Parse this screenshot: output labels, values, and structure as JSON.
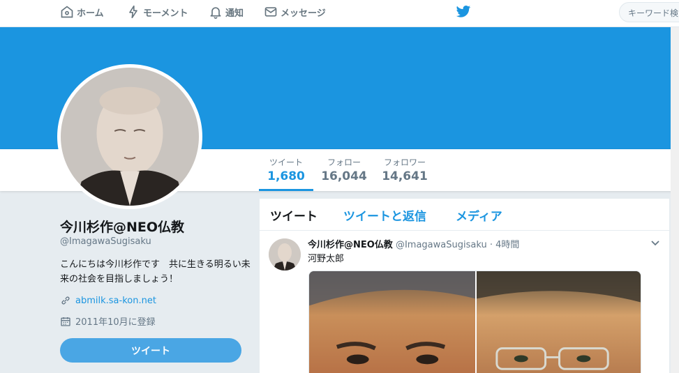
{
  "nav": {
    "home": "ホーム",
    "moments": "モーメント",
    "notifications": "通知",
    "messages": "メッセージ",
    "search_placeholder": "キーワード検"
  },
  "icons": {
    "home": "home-icon",
    "moments": "lightning-icon",
    "notifications": "bell-icon",
    "messages": "envelope-icon",
    "logo": "twitter-bird-icon",
    "link": "link-icon",
    "calendar": "calendar-icon",
    "caret": "chevron-down-icon"
  },
  "colors": {
    "brand": "#1b95e0",
    "banner": "#1b95e0",
    "button": "#4aa6e4"
  },
  "stats": {
    "tweets_label": "ツイート",
    "tweets_value": "1,680",
    "following_label": "フォロー",
    "following_value": "16,044",
    "followers_label": "フォロワー",
    "followers_value": "14,641"
  },
  "profile": {
    "name": "今川杉作@NEO仏教",
    "handle": "@ImagawaSugisaku",
    "bio": "こんにちは今川杉作です　共に生きる明るい未来の社会を目指しましょう！",
    "link": "abmilk.sa-kon.net",
    "joined": "2011年10月に登録",
    "tweet_button": "ツイート"
  },
  "timeline": {
    "tabs": [
      "ツイート",
      "ツイートと返信",
      "メディア"
    ],
    "tweet": {
      "author": "今川杉作@NEO仏教",
      "handle": "@ImagawaSugisaku",
      "dot": "·",
      "time": "4時間",
      "text": "河野太郎"
    }
  }
}
